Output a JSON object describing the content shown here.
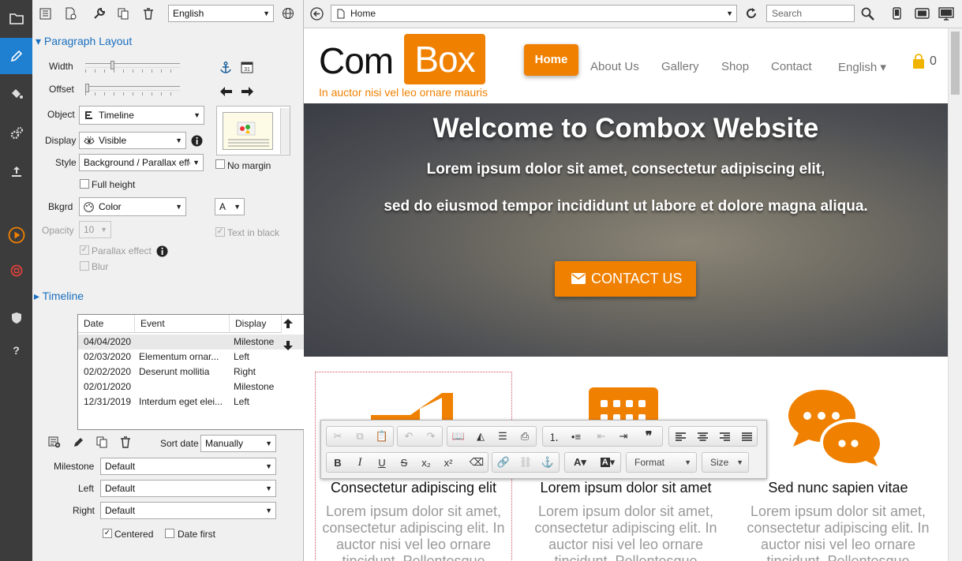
{
  "left_rail": {
    "items": [
      {
        "icon": "folder-icon"
      },
      {
        "icon": "pencil-icon"
      },
      {
        "icon": "paint-bucket-icon"
      },
      {
        "icon": "gears-icon"
      },
      {
        "icon": "upload-icon"
      },
      {
        "icon": "play-icon"
      },
      {
        "icon": "stop-icon"
      },
      {
        "icon": "shield-icon"
      },
      {
        "icon": "help-icon",
        "glyph": "?"
      }
    ]
  },
  "panel_toolbar": {
    "language": "English"
  },
  "paragraph_layout": {
    "title": "Paragraph Layout",
    "width_label": "Width",
    "offset_label": "Offset",
    "object_label": "Object",
    "object_value": "Timeline",
    "display_label": "Display",
    "display_value": "Visible",
    "style_label": "Style",
    "style_value": "Background / Parallax effe",
    "no_margin_label": "No margin",
    "full_height_label": "Full height",
    "bkgrd_label": "Bkgrd",
    "bkgrd_value": "Color",
    "font_value": "A",
    "opacity_label": "Opacity",
    "opacity_value": "10",
    "text_in_black_label": "Text in black",
    "parallax_label": "Parallax effect",
    "blur_label": "Blur",
    "calendar_day": "31"
  },
  "timeline": {
    "title": "Timeline",
    "columns": [
      "Date",
      "Event",
      "Display"
    ],
    "rows": [
      {
        "date": "04/04/2020",
        "event": "",
        "display": "Milestone"
      },
      {
        "date": "02/03/2020",
        "event": "Elementum ornar...",
        "display": "Left"
      },
      {
        "date": "02/02/2020",
        "event": "Deserunt mollitia",
        "display": "Right"
      },
      {
        "date": "02/01/2020",
        "event": "",
        "display": "Milestone"
      },
      {
        "date": "12/31/2019",
        "event": "Interdum eget elei...",
        "display": "Left"
      }
    ],
    "sort_label": "Sort date",
    "sort_value": "Manually",
    "milestone_label": "Milestone",
    "milestone_value": "Default",
    "left_label": "Left",
    "left_value": "Default",
    "right_label": "Right",
    "right_value": "Default",
    "centered_label": "Centered",
    "date_first_label": "Date first"
  },
  "browser": {
    "address": "Home",
    "search_placeholder": "Search"
  },
  "site": {
    "logo_left": "Com",
    "logo_right": "Box",
    "tagline": "In auctor nisi vel leo ornare mauris",
    "nav": [
      "Home",
      "About Us",
      "Gallery",
      "Shop",
      "Contact",
      "English ▾"
    ],
    "cart_count": "0",
    "hero_title": "Welcome to Combox Website",
    "hero_line1": "Lorem ipsum dolor sit amet, consectetur adipiscing elit,",
    "hero_line2": "sed do eiusmod tempor incididunt ut labore et dolore magna aliqua.",
    "cta": "CONTACT US",
    "features": [
      {
        "title": "Consectetur adipiscing elit",
        "text": "Lorem ipsum dolor sit amet, consectetur adipiscing elit. In auctor nisi vel leo ornare tincidunt. Pellentesque"
      },
      {
        "title": "Lorem ipsum dolor sit amet",
        "text": "Lorem ipsum dolor sit amet, consectetur adipiscing elit. In auctor nisi vel leo ornare tincidunt. Pellentesque"
      },
      {
        "title": "Sed nunc sapien vitae",
        "text": "Lorem ipsum dolor sit amet, consectetur adipiscing elit. In auctor nisi vel leo ornare tincidunt. Pellentesque"
      }
    ],
    "accent": "#f08000"
  },
  "editor_toolbar": {
    "format_label": "Format",
    "size_label": "Size"
  }
}
